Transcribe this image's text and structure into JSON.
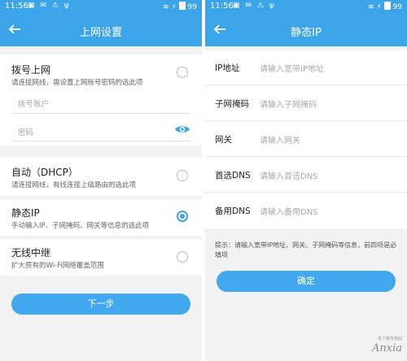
{
  "status": {
    "time": "11:56",
    "battery": "99"
  },
  "left": {
    "title": "上网设置",
    "options": [
      {
        "title": "拨号上网",
        "subtitle": "请连接网线，需设置上网账号密码的选此项"
      },
      {
        "title": "自动（DHCP）",
        "subtitle": "请连接网线，有线连接上级路由的选此项"
      },
      {
        "title": "静态IP",
        "subtitle": "手动输入IP、子网掩码、网关等信息的选此项",
        "checked": true
      },
      {
        "title": "无线中继",
        "subtitle": "扩大原有的Wi-Fi网络覆盖范围"
      }
    ],
    "account_placeholder": "拨号账户",
    "password_placeholder": "密码",
    "next_label": "下一步"
  },
  "right": {
    "title": "静态IP",
    "fields": [
      {
        "label": "IP地址",
        "placeholder": "请输入宽带IP地址"
      },
      {
        "label": "子网掩码",
        "placeholder": "请输入子网掩码"
      },
      {
        "label": "网关",
        "placeholder": "请输入网关"
      },
      {
        "label": "首选DNS",
        "placeholder": "请输入首选DNS"
      },
      {
        "label": "备用DNS",
        "placeholder": "请输入备用DNS"
      }
    ],
    "tip": "提示：请输入宽带IP地址、网关、子网掩码等信息，前四项是必填项",
    "confirm_label": "确定"
  },
  "watermark": {
    "text": "Anxia",
    "sub": "安下载专用站"
  },
  "colors": {
    "accent": "#3ca4e9"
  }
}
